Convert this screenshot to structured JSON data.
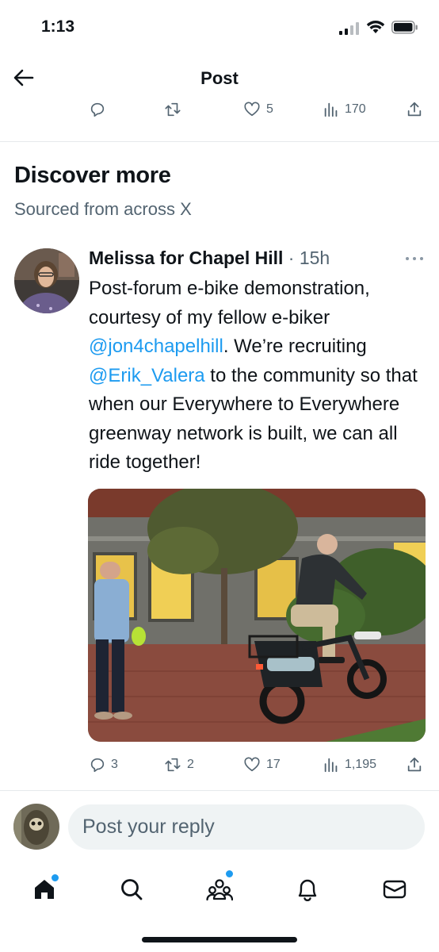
{
  "status_bar": {
    "time": "1:13"
  },
  "nav": {
    "title": "Post"
  },
  "top_actions": {
    "reply": "",
    "repost": "",
    "like": "5",
    "views": "170"
  },
  "discover": {
    "title": "Discover more",
    "subtitle": "Sourced from across X"
  },
  "post": {
    "author": "Melissa for Chapel Hill",
    "meta": " · 15h",
    "text": {
      "part1": "Post-forum e-bike demonstration, courtesy of my fellow e-biker ",
      "mention1": "@jon4chapelhill",
      "part2": ". We’re recruiting ",
      "mention2": "@Erik_Valera",
      "part3": " to the community so that when our Everywhere to Everywhere greenway network is built, we can all ride together!"
    },
    "actions": {
      "reply": "3",
      "repost": "2",
      "like": "17",
      "views": "1,195"
    }
  },
  "reply": {
    "placeholder": "Post your reply"
  },
  "tabs": [
    {
      "icon": "home-icon",
      "badge": true
    },
    {
      "icon": "search-icon",
      "badge": false
    },
    {
      "icon": "communities-icon",
      "badge": true
    },
    {
      "icon": "bell-icon",
      "badge": false
    },
    {
      "icon": "mail-icon",
      "badge": false
    }
  ],
  "colors": {
    "accent": "#1d9bf0",
    "muted": "#536471",
    "text": "#0f1419"
  }
}
